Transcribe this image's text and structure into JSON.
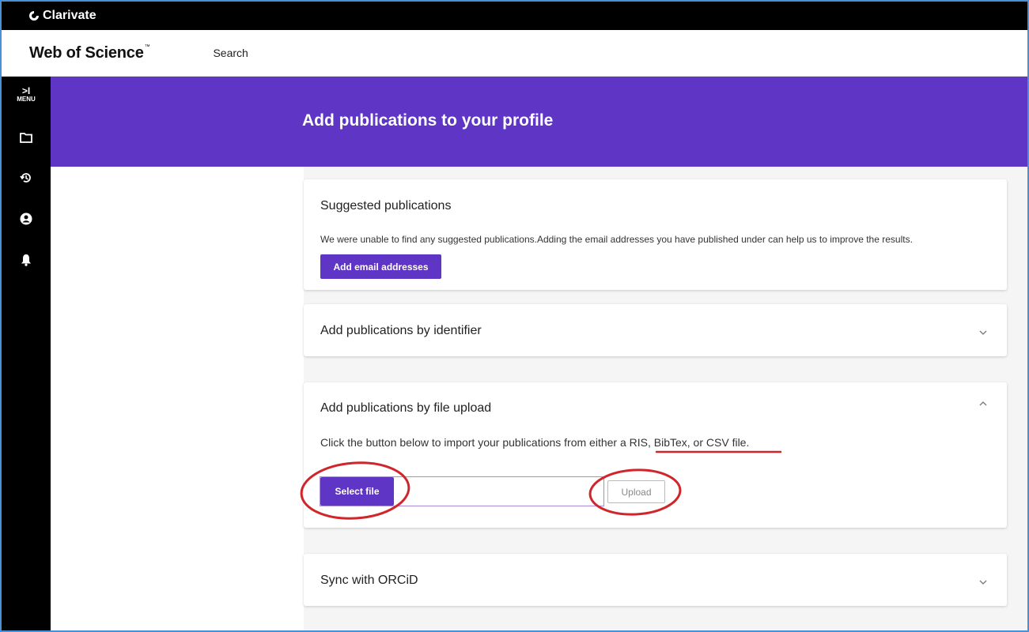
{
  "topbar": {
    "brand": "Clarivate"
  },
  "header": {
    "product": "Web of Science",
    "trademark": "™",
    "search_link": "Search"
  },
  "sidebar": {
    "menu_arrow": ">I",
    "menu_label": "MENU",
    "icons": [
      "folder-icon",
      "history-icon",
      "user-icon",
      "bell-icon"
    ]
  },
  "banner": {
    "title": "Add publications to your profile"
  },
  "suggested": {
    "title": "Suggested publications",
    "message": "We were unable to find any suggested publications.Adding the email addresses you have published under can help us to improve the results.",
    "button": "Add email addresses"
  },
  "identifier": {
    "title": "Add publications by identifier"
  },
  "file_upload": {
    "title": "Add publications by file upload",
    "text_before": "Click the button below to import your publications from either a ",
    "text_formats": "RIS, BibTex, or CSV file.",
    "select_button": "Select file",
    "upload_button": "Upload"
  },
  "orcid": {
    "title": "Sync with ORCiD"
  },
  "colors": {
    "accent": "#5e35c4",
    "annotation": "#d0262b",
    "frame": "#4a90d9"
  }
}
